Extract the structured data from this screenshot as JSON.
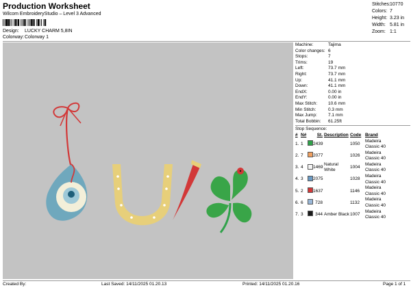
{
  "header": {
    "title": "Production Worksheet",
    "subtitle": "Wilcom EmbroideryStudio – Level 3 Advanced",
    "design_label": "Design:",
    "design_value": "LUCKY CHARM 5,8IN",
    "colorway_label": "Colorway:",
    "colorway_value": "Colorway 1"
  },
  "summary": [
    {
      "k": "Stitches:",
      "v": "10770"
    },
    {
      "k": "Colors:",
      "v": "7"
    },
    {
      "k": "Height:",
      "v": "3.23 in"
    },
    {
      "k": "Width:",
      "v": "5.81 in"
    },
    {
      "k": "Zoom:",
      "v": "1:1"
    }
  ],
  "machine_info": [
    {
      "k": "Machine:",
      "v": "Tajima"
    },
    {
      "k": "Color changes:",
      "v": "6"
    },
    {
      "k": "Stops:",
      "v": "7"
    },
    {
      "k": "Trims:",
      "v": "19"
    },
    {
      "k": "Left:",
      "v": "73.7 mm"
    },
    {
      "k": "Right:",
      "v": "73.7 mm"
    },
    {
      "k": "Up:",
      "v": "41.1 mm"
    },
    {
      "k": "Down:",
      "v": "41.1 mm"
    },
    {
      "k": "EndX:",
      "v": "0.00 in"
    },
    {
      "k": "EndY:",
      "v": "0.00 in"
    },
    {
      "k": "Max Stitch:",
      "v": "10.6 mm"
    },
    {
      "k": "Min Stitch:",
      "v": "0.3 mm"
    },
    {
      "k": "Max Jump:",
      "v": "7.1 mm"
    },
    {
      "k": "Total Bobbin:",
      "v": "61.25ft"
    }
  ],
  "stop_sequence": {
    "title": "Stop Sequence:",
    "headers": [
      "#",
      "N#",
      "St.",
      "Description",
      "Code",
      "Brand"
    ],
    "rows": [
      {
        "n": "1.",
        "nn": "1",
        "color": "#2fa24a",
        "st": "2439",
        "desc": "",
        "code": "1050",
        "brand": "Madeira Classic 40"
      },
      {
        "n": "2.",
        "nn": "7",
        "color": "#f0a060",
        "st": "2077",
        "desc": "",
        "code": "1026",
        "brand": "Madeira Classic 40"
      },
      {
        "n": "3.",
        "nn": "4",
        "color": "#f4f4f4",
        "st": "1469",
        "desc": "Natural White",
        "code": "1004",
        "brand": "Madeira Classic 40"
      },
      {
        "n": "4.",
        "nn": "3",
        "color": "#6a9ac4",
        "st": "2075",
        "desc": "",
        "code": "1028",
        "brand": "Madeira Classic 40"
      },
      {
        "n": "5.",
        "nn": "2",
        "color": "#d23838",
        "st": "1637",
        "desc": "",
        "code": "1146",
        "brand": "Madeira Classic 40"
      },
      {
        "n": "6.",
        "nn": "6",
        "color": "#9ab8d8",
        "st": "728",
        "desc": "",
        "code": "1132",
        "brand": "Madeira Classic 40"
      },
      {
        "n": "7.",
        "nn": "3",
        "color": "#1a1a1a",
        "st": "344",
        "desc": "Amber Black",
        "code": "1007",
        "brand": "Madeira Classic 40"
      }
    ]
  },
  "footer": {
    "created": "Created By:",
    "saved": "Last Saved: 14/11/2025 01.20.13",
    "printed": "Printed: 14/11/2025 01.20.16",
    "page": "Page 1 of 1"
  },
  "colors": {
    "preview_bg": "#c3c3c3",
    "eye_blue": "#6fa8bd",
    "horseshoe": "#e7cf7a",
    "horn_red": "#d23838",
    "clover_green": "#2fa24a"
  }
}
